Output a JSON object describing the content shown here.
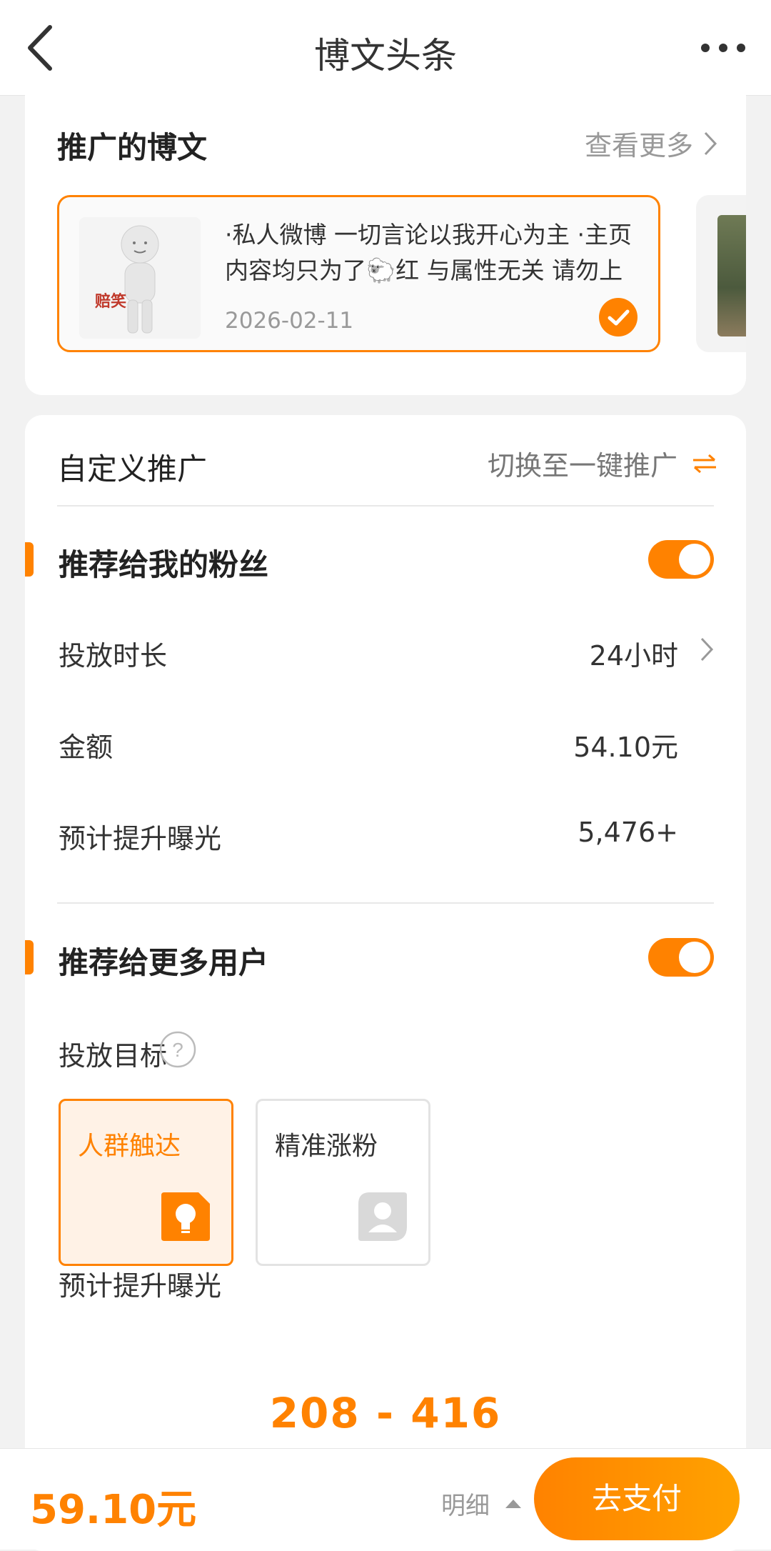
{
  "header": {
    "title": "博文头条",
    "back_icon": "chevron-left-icon",
    "more_icon": "more-dots-icon"
  },
  "promoted_posts": {
    "title": "推广的博文",
    "more_label": "查看更多",
    "post": {
      "thumb_caption": "赔笑",
      "text": "·私人微博 一切言论以我开心为主 ·主页内容均只为了🐑红 与属性无关 请勿上升http://t.cn/A",
      "date": "2026-02-11",
      "selected": true
    }
  },
  "custom": {
    "title": "自定义推广",
    "switch_label": "切换至一键推广",
    "switch_icon": "swap-arrows-icon"
  },
  "fans_section": {
    "title": "推荐给我的粉丝",
    "enabled": true,
    "rows": [
      {
        "label": "投放时长",
        "value": "24小时"
      },
      {
        "label": "金额",
        "value": "54.10元"
      },
      {
        "label": "预计提升曝光",
        "value": "5,476+"
      }
    ]
  },
  "more_users_section": {
    "title": "推荐给更多用户",
    "enabled": true,
    "goal_label": "投放目标",
    "goals": [
      {
        "label": "人群触达",
        "icon": "lightbulb-icon",
        "selected": true
      },
      {
        "label": "精准涨粉",
        "icon": "user-plus-icon",
        "selected": false
      }
    ],
    "exposure_label": "预计提升曝光",
    "exposure_range": "208 - 416"
  },
  "footer": {
    "total": "59.10元",
    "detail_label": "明细",
    "pay_label": "去支付"
  },
  "colors": {
    "accent": "#ff8200",
    "accent_light": "#fff2e6",
    "background": "#f2f2f2"
  }
}
